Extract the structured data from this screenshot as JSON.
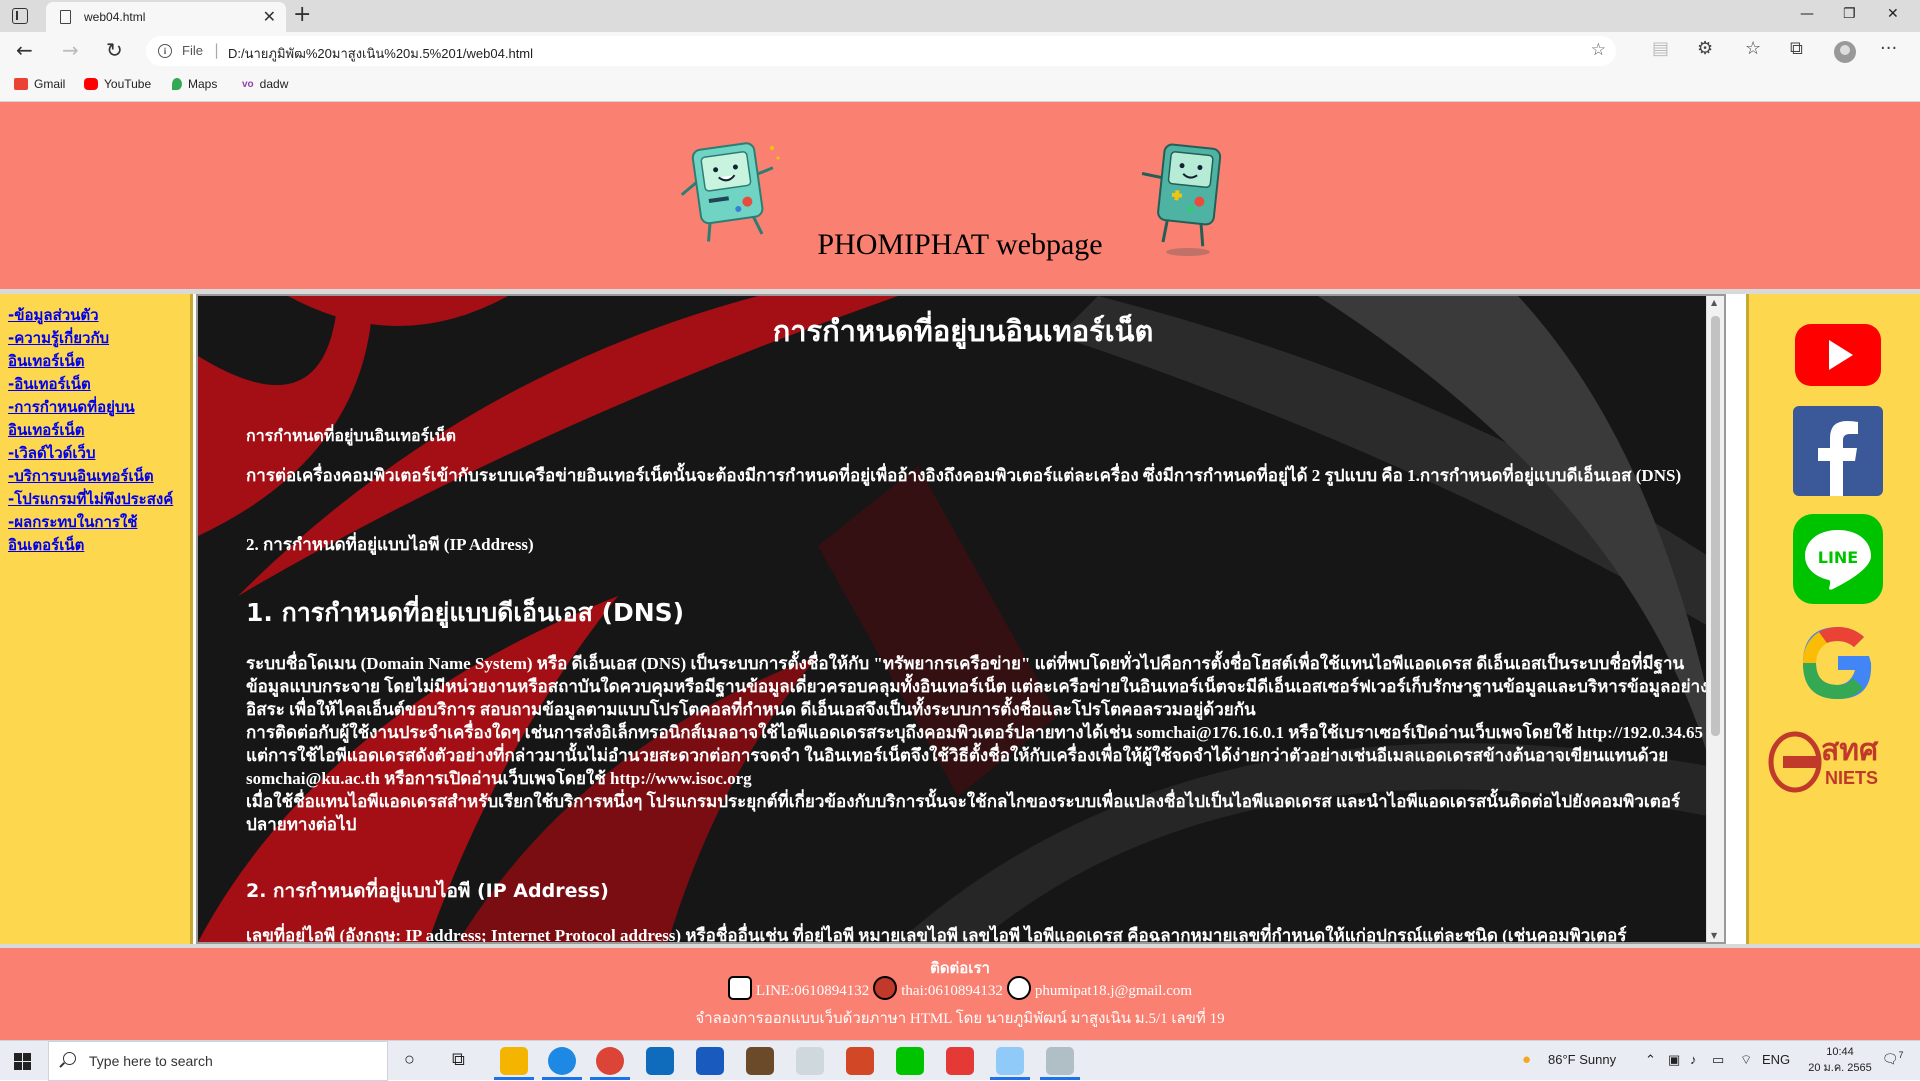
{
  "browser": {
    "tab_title": "web04.html",
    "url_scheme": "File",
    "url": "D:/นายภูมิพัฒ%20มาสูงเนิน%20ม.5%201/web04.html",
    "bookmarks": [
      "Gmail",
      "YouTube",
      "Maps",
      "dadw"
    ]
  },
  "header": {
    "site_title": "PHOMIPHAT webpage"
  },
  "nav": {
    "items": [
      "-ข้อมูลส่วนตัว",
      "-ความรู้เกี่ยวกับอินเทอร์เน็ต",
      "-อินเทอร์เน็ต",
      "-การกำหนดที่อยู่บนอินเทอร์เน็ต",
      "-เวิลด์ไวด์เว็บ",
      "-บริการบนอินเทอร์เน็ต",
      "-โปรแกรมที่ไม่พึงประสงค์",
      "-ผลกระทบในการใช้อินเตอร์เน็ต"
    ]
  },
  "content": {
    "heading": "การกำหนดที่อยู่บนอินเทอร์เน็ต",
    "subheading": "การกำหนดที่อยู่บนอินเทอร์เน็ต",
    "intro": "การต่อเครื่องคอมพิวเตอร์เข้ากับระบบเครือข่ายอินเทอร์เน็ตนั้นจะต้องมีการกำหนดที่อยู่เพื่ออ้างอิงถึงคอมพิวเตอร์แต่ละเครื่อง ซึ่งมีการกำหนดที่อยู่ได้ 2 รูปแบบ คือ 1.การกำหนดที่อยู่แบบดีเอ็นเอส (DNS)",
    "intro_item2": "2. การกำหนดที่อยู่แบบไอพี (IP Address)",
    "section1_title": "1. การกำหนดที่อยู่แบบดีเอ็นเอส (DNS)",
    "section1_p1": "ระบบชื่อโดเมน (Domain Name System) หรือ ดีเอ็นเอส (DNS) เป็นระบบการตั้งชื่อให้กับ \"ทรัพยากรเครือข่าย\" แต่ที่พบโดยทั่วไปคือการตั้งชื่อโฮสต์เพื่อใช้แทนไอพีแอดเดรส ดีเอ็นเอสเป็นระบบชื่อที่มีฐานข้อมูลแบบกระจาย โดยไม่มีหน่วยงานหรือสถาบันใดควบคุมหรือมีฐานข้อมูลเดี่ยวครอบคลุมทั้งอินเทอร์เน็ต แต่ละเครือข่ายในอินเทอร์เน็ตจะมีดีเอ็นเอสเซอร์ฟเวอร์เก็บรักษาฐานข้อมูลและบริหารข้อมูลอย่างอิสระ เพื่อให้ไคลเอ็นต์ขอบริการ สอบถามข้อมูลตามแบบโปรโตคอลที่กำหนด ดีเอ็นเอสจึงเป็นทั้งระบบการตั้งชื่อและโปรโตคอลรวมอยู่ด้วยกัน",
    "section1_p2": "การติดต่อกับผู้ใช้งานประจำเครื่องใดๆ เช่นการส่งอิเล็กทรอนิกส์เมลอาจใช้ไอพีแอดเดรสระบุถึงคอมพิวเตอร์ปลายทางได้เช่น somchai@176.16.0.1 หรือใช้เบราเซอร์เปิดอ่านเว็บเพจโดยใช้ http://192.0.34.65 แต่การใช้ไอพีแอดเดรสดังตัวอย่างที่กล่าวมานั้นไม่อำนวยสะดวกต่อการจดจำ ในอินเทอร์เน็ตจึงใช้วิธีตั้งชื่อให้กับเครื่องเพื่อให้ผู้ใช้จดจำได้ง่ายกว่าตัวอย่างเช่นอีเมลแอดเดรสข้างต้นอาจเขียนแทนด้วย somchai@ku.ac.th หรือการเปิดอ่านเว็บเพจโดยใช้ http://www.isoc.org",
    "section1_p3": "เมื่อใช้ชื่อแทนไอพีแอดเดรสสำหรับเรียกใช้บริการหนึ่งๆ โปรแกรมประยุกต์ที่เกี่ยวข้องกับบริการนั้นจะใช้กลไกของระบบเพื่อแปลงชื่อไปเป็นไอพีแอดเดรส และนำไอพีแอดเดรสนั้นติดต่อไปยังคอมพิวเตอร์ปลายทางต่อไป",
    "section2_title": "2. การกำหนดที่อยู่แบบไอพี (IP Address)",
    "section2_p1": "เลขที่อยู่ไอพี (อังกฤษ: IP address; Internet Protocol address) หรือชื่ออื่นเช่น ที่อยู่ไอพี หมายเลขไอพี เลขไอพี ไอพีแอดเดรส คือฉลากหมายเลขที่กำหนดให้แก่อุปกรณ์แต่ละชนิด (เช่นคอมพิวเตอร์"
  },
  "social": [
    "YouTube",
    "Facebook",
    "LINE",
    "Google",
    "NIETS"
  ],
  "footer": {
    "title": "ติดต่อเรา",
    "line": "LINE:0610894132",
    "phone": "thai:0610894132",
    "email": "phumipat18.j@gmail.com",
    "note": "จำลองการออกแบบเว็บด้วยภาษา HTML โดย นายภูมิพัฒน์ มาสูงเนิน ม.5/1 เลขที่ 19"
  },
  "taskbar": {
    "search_placeholder": "Type here to search",
    "weather": "86°F  Sunny",
    "lang": "ENG",
    "time": "10:44",
    "date": "20 ม.ค. 2565",
    "notif_count": "7"
  }
}
